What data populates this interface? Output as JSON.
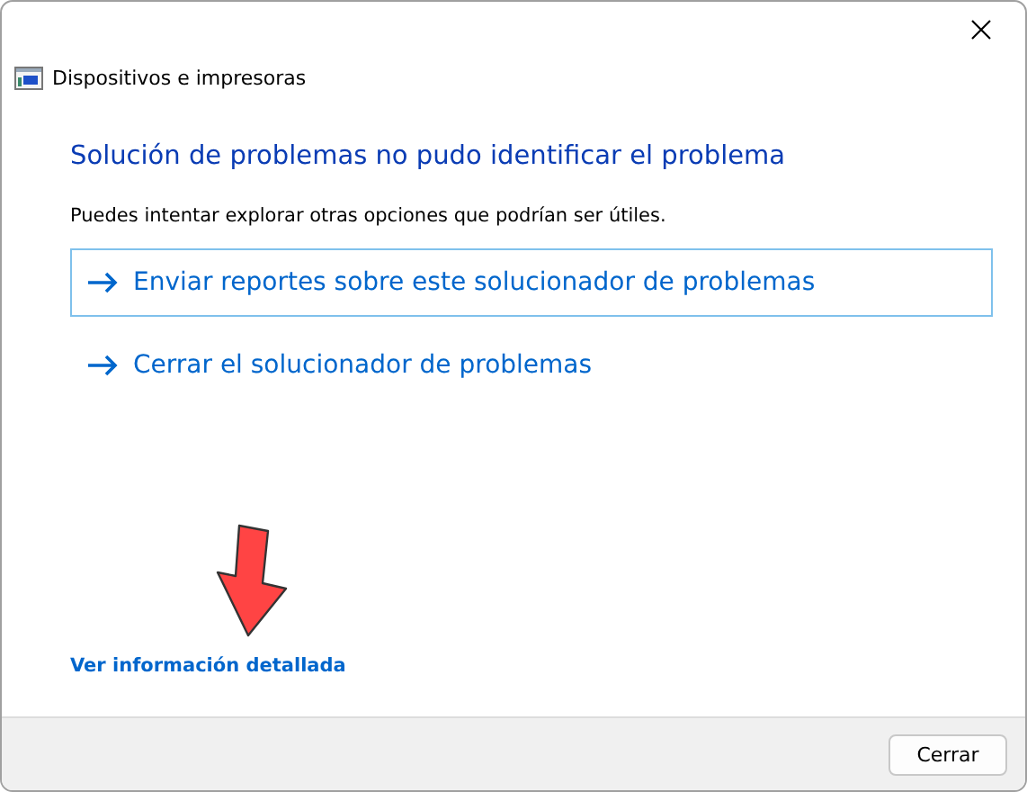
{
  "window": {
    "title": "Dispositivos e impresoras"
  },
  "heading": "Solución de problemas no pudo identificar el problema",
  "intro": "Puedes intentar explorar otras opciones que podrían ser útiles.",
  "options": [
    {
      "label": "Enviar reportes sobre este solucionador de problemas",
      "focused": true
    },
    {
      "label": "Cerrar el solucionador de problemas",
      "focused": false
    }
  ],
  "details_link": "Ver información detallada",
  "annotation": {
    "kind": "arrow"
  },
  "buttons": [
    "Cerrar"
  ]
}
